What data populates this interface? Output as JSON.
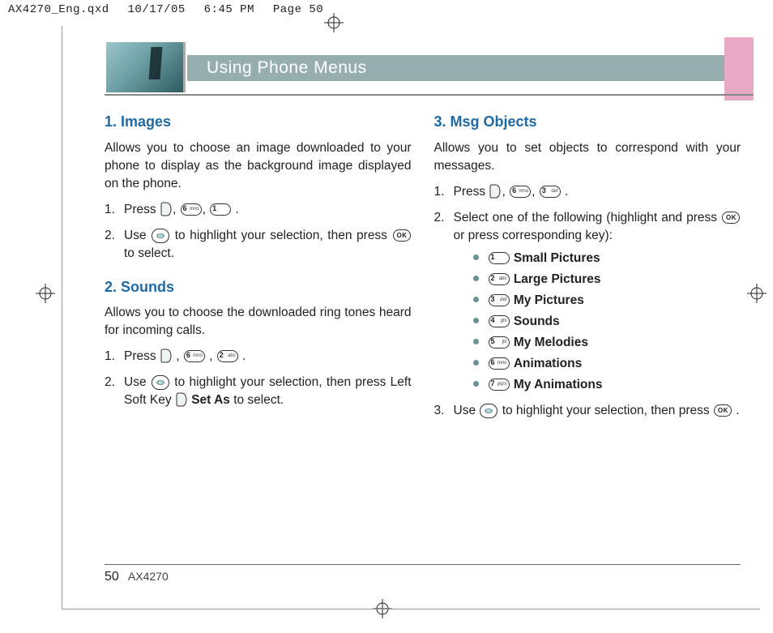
{
  "slug": {
    "file": "AX4270_Eng.qxd",
    "date": "10/17/05",
    "time": "6:45 PM",
    "page": "Page 50"
  },
  "banner": {
    "title": "Using Phone Menus"
  },
  "left": {
    "s1": {
      "heading": "1. Images",
      "intro": "Allows you to choose an image downloaded to your phone to display as the background image displayed on the phone.",
      "step1_a": "Press",
      "step1_b": ".",
      "step2_a": "Use",
      "step2_b": "to highlight your selection, then press",
      "step2_c": "to select."
    },
    "s2": {
      "heading": "2. Sounds",
      "intro": "Allows you to choose the downloaded ring tones heard for incoming calls.",
      "step1_a": "Press",
      "step1_b": ".",
      "step2_a": "Use",
      "step2_b": "to highlight your selection, then press Left Soft Key",
      "step2_c": "Set As",
      "step2_d": "to select."
    }
  },
  "right": {
    "s3": {
      "heading": "3. Msg Objects",
      "intro": "Allows you to set objects to correspond with your messages.",
      "step1_a": "Press",
      "step1_b": ".",
      "step2_a": "Select one of the following (highlight and press",
      "step2_b": "or press corresponding key):",
      "options": [
        {
          "key": "1",
          "sub": "",
          "label": "Small Pictures"
        },
        {
          "key": "2",
          "sub": "abc",
          "label": "Large Pictures"
        },
        {
          "key": "3",
          "sub": "def",
          "label": "My Pictures"
        },
        {
          "key": "4",
          "sub": "ghi",
          "label": "Sounds"
        },
        {
          "key": "5",
          "sub": "jkl",
          "label": "My Melodies"
        },
        {
          "key": "6",
          "sub": "mno",
          "label": "Animations"
        },
        {
          "key": "7",
          "sub": "pqrs",
          "label": "My Animations"
        }
      ],
      "step3_a": "Use",
      "step3_b": "to highlight your selection, then press",
      "step3_c": "."
    }
  },
  "keys": {
    "k1": {
      "n": "1",
      "s": ""
    },
    "k2": {
      "n": "2",
      "s": "abc"
    },
    "k3": {
      "n": "3",
      "s": "def"
    },
    "k6": {
      "n": "6",
      "s": "mno"
    },
    "ok": "OK"
  },
  "footer": {
    "page": "50",
    "model": "AX4270"
  }
}
